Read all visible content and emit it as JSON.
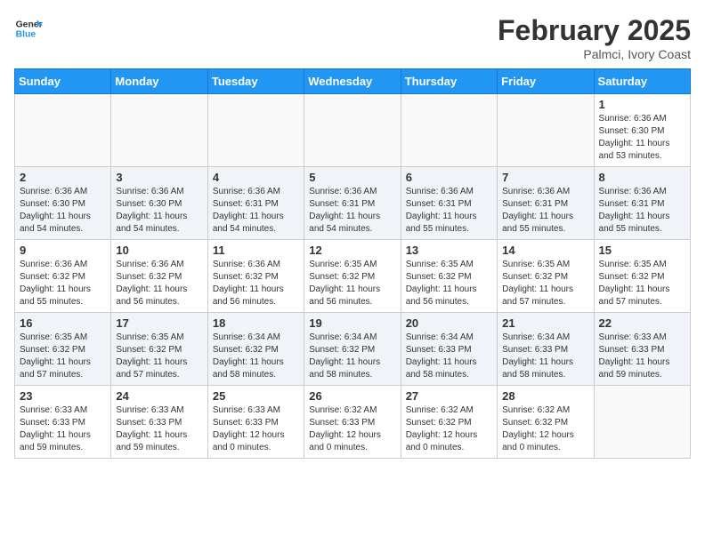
{
  "header": {
    "logo_general": "General",
    "logo_blue": "Blue",
    "month": "February 2025",
    "location": "Palmci, Ivory Coast"
  },
  "days_of_week": [
    "Sunday",
    "Monday",
    "Tuesday",
    "Wednesday",
    "Thursday",
    "Friday",
    "Saturday"
  ],
  "weeks": [
    {
      "alt": false,
      "days": [
        {
          "num": "",
          "info": ""
        },
        {
          "num": "",
          "info": ""
        },
        {
          "num": "",
          "info": ""
        },
        {
          "num": "",
          "info": ""
        },
        {
          "num": "",
          "info": ""
        },
        {
          "num": "",
          "info": ""
        },
        {
          "num": "1",
          "info": "Sunrise: 6:36 AM\nSunset: 6:30 PM\nDaylight: 11 hours and 53 minutes."
        }
      ]
    },
    {
      "alt": true,
      "days": [
        {
          "num": "2",
          "info": "Sunrise: 6:36 AM\nSunset: 6:30 PM\nDaylight: 11 hours and 54 minutes."
        },
        {
          "num": "3",
          "info": "Sunrise: 6:36 AM\nSunset: 6:30 PM\nDaylight: 11 hours and 54 minutes."
        },
        {
          "num": "4",
          "info": "Sunrise: 6:36 AM\nSunset: 6:31 PM\nDaylight: 11 hours and 54 minutes."
        },
        {
          "num": "5",
          "info": "Sunrise: 6:36 AM\nSunset: 6:31 PM\nDaylight: 11 hours and 54 minutes."
        },
        {
          "num": "6",
          "info": "Sunrise: 6:36 AM\nSunset: 6:31 PM\nDaylight: 11 hours and 55 minutes."
        },
        {
          "num": "7",
          "info": "Sunrise: 6:36 AM\nSunset: 6:31 PM\nDaylight: 11 hours and 55 minutes."
        },
        {
          "num": "8",
          "info": "Sunrise: 6:36 AM\nSunset: 6:31 PM\nDaylight: 11 hours and 55 minutes."
        }
      ]
    },
    {
      "alt": false,
      "days": [
        {
          "num": "9",
          "info": "Sunrise: 6:36 AM\nSunset: 6:32 PM\nDaylight: 11 hours and 55 minutes."
        },
        {
          "num": "10",
          "info": "Sunrise: 6:36 AM\nSunset: 6:32 PM\nDaylight: 11 hours and 56 minutes."
        },
        {
          "num": "11",
          "info": "Sunrise: 6:36 AM\nSunset: 6:32 PM\nDaylight: 11 hours and 56 minutes."
        },
        {
          "num": "12",
          "info": "Sunrise: 6:35 AM\nSunset: 6:32 PM\nDaylight: 11 hours and 56 minutes."
        },
        {
          "num": "13",
          "info": "Sunrise: 6:35 AM\nSunset: 6:32 PM\nDaylight: 11 hours and 56 minutes."
        },
        {
          "num": "14",
          "info": "Sunrise: 6:35 AM\nSunset: 6:32 PM\nDaylight: 11 hours and 57 minutes."
        },
        {
          "num": "15",
          "info": "Sunrise: 6:35 AM\nSunset: 6:32 PM\nDaylight: 11 hours and 57 minutes."
        }
      ]
    },
    {
      "alt": true,
      "days": [
        {
          "num": "16",
          "info": "Sunrise: 6:35 AM\nSunset: 6:32 PM\nDaylight: 11 hours and 57 minutes."
        },
        {
          "num": "17",
          "info": "Sunrise: 6:35 AM\nSunset: 6:32 PM\nDaylight: 11 hours and 57 minutes."
        },
        {
          "num": "18",
          "info": "Sunrise: 6:34 AM\nSunset: 6:32 PM\nDaylight: 11 hours and 58 minutes."
        },
        {
          "num": "19",
          "info": "Sunrise: 6:34 AM\nSunset: 6:32 PM\nDaylight: 11 hours and 58 minutes."
        },
        {
          "num": "20",
          "info": "Sunrise: 6:34 AM\nSunset: 6:33 PM\nDaylight: 11 hours and 58 minutes."
        },
        {
          "num": "21",
          "info": "Sunrise: 6:34 AM\nSunset: 6:33 PM\nDaylight: 11 hours and 58 minutes."
        },
        {
          "num": "22",
          "info": "Sunrise: 6:33 AM\nSunset: 6:33 PM\nDaylight: 11 hours and 59 minutes."
        }
      ]
    },
    {
      "alt": false,
      "days": [
        {
          "num": "23",
          "info": "Sunrise: 6:33 AM\nSunset: 6:33 PM\nDaylight: 11 hours and 59 minutes."
        },
        {
          "num": "24",
          "info": "Sunrise: 6:33 AM\nSunset: 6:33 PM\nDaylight: 11 hours and 59 minutes."
        },
        {
          "num": "25",
          "info": "Sunrise: 6:33 AM\nSunset: 6:33 PM\nDaylight: 12 hours and 0 minutes."
        },
        {
          "num": "26",
          "info": "Sunrise: 6:32 AM\nSunset: 6:33 PM\nDaylight: 12 hours and 0 minutes."
        },
        {
          "num": "27",
          "info": "Sunrise: 6:32 AM\nSunset: 6:32 PM\nDaylight: 12 hours and 0 minutes."
        },
        {
          "num": "28",
          "info": "Sunrise: 6:32 AM\nSunset: 6:32 PM\nDaylight: 12 hours and 0 minutes."
        },
        {
          "num": "",
          "info": ""
        }
      ]
    }
  ]
}
